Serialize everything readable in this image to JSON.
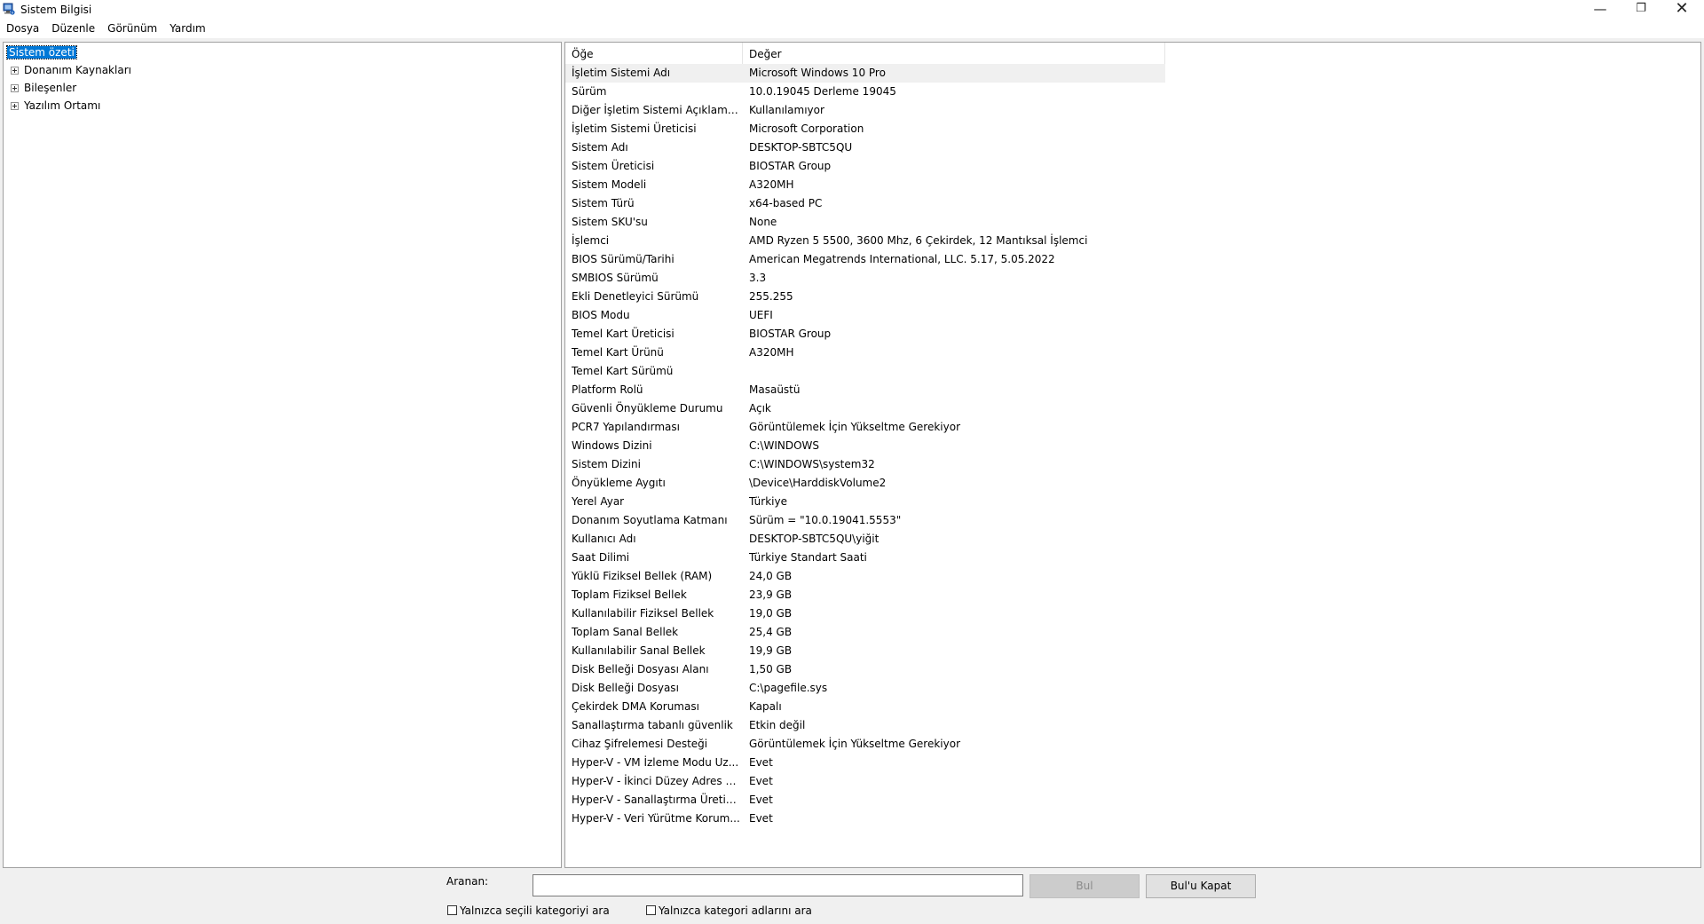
{
  "window": {
    "title": "Sistem Bilgisi",
    "app_icon": "system-information-icon",
    "controls": {
      "minimize": "—",
      "maximize": "❐",
      "close": "✕"
    }
  },
  "menu": [
    "Dosya",
    "Düzenle",
    "Görünüm",
    "Yardım"
  ],
  "tree": {
    "items": [
      {
        "label": "Sistem özeti",
        "expandable": false,
        "selected": true
      },
      {
        "label": "Donanım Kaynakları",
        "expandable": true
      },
      {
        "label": "Bileşenler",
        "expandable": true
      },
      {
        "label": "Yazılım Ortamı",
        "expandable": true
      }
    ]
  },
  "table": {
    "headers": [
      "Öğe",
      "Değer"
    ],
    "rows": [
      [
        "İşletim Sistemi Adı",
        "Microsoft Windows 10 Pro"
      ],
      [
        "Sürüm",
        "10.0.19045 Derleme 19045"
      ],
      [
        "Diğer İşletim Sistemi Açıklaması",
        "Kullanılamıyor"
      ],
      [
        "İşletim Sistemi Üreticisi",
        "Microsoft Corporation"
      ],
      [
        "Sistem Adı",
        "DESKTOP-SBTC5QU"
      ],
      [
        "Sistem Üreticisi",
        "BIOSTAR Group"
      ],
      [
        "Sistem Modeli",
        "A320MH"
      ],
      [
        "Sistem Türü",
        "x64-based PC"
      ],
      [
        "Sistem SKU'su",
        "None"
      ],
      [
        "İşlemci",
        "AMD Ryzen 5 5500, 3600 Mhz, 6 Çekirdek, 12 Mantıksal İşlemci"
      ],
      [
        "BIOS Sürümü/Tarihi",
        "American Megatrends International, LLC. 5.17, 5.05.2022"
      ],
      [
        "SMBIOS Sürümü",
        "3.3"
      ],
      [
        "Ekli Denetleyici Sürümü",
        "255.255"
      ],
      [
        "BIOS Modu",
        "UEFI"
      ],
      [
        "Temel Kart Üreticisi",
        "BIOSTAR Group"
      ],
      [
        "Temel Kart Ürünü",
        "A320MH"
      ],
      [
        "Temel Kart Sürümü",
        ""
      ],
      [
        "Platform Rolü",
        "Masaüstü"
      ],
      [
        "Güvenli Önyükleme Durumu",
        "Açık"
      ],
      [
        "PCR7 Yapılandırması",
        "Görüntülemek İçin Yükseltme Gerekiyor"
      ],
      [
        "Windows Dizini",
        "C:\\WINDOWS"
      ],
      [
        "Sistem Dizini",
        "C:\\WINDOWS\\system32"
      ],
      [
        "Önyükleme Aygıtı",
        "\\Device\\HarddiskVolume2"
      ],
      [
        "Yerel Ayar",
        "Türkiye"
      ],
      [
        "Donanım Soyutlama Katmanı",
        "Sürüm = \"10.0.19041.5553\""
      ],
      [
        "Kullanıcı Adı",
        "DESKTOP-SBTC5QU\\yiğit"
      ],
      [
        "Saat Dilimi",
        "Türkiye Standart Saati"
      ],
      [
        "Yüklü Fiziksel Bellek (RAM)",
        "24,0 GB"
      ],
      [
        "Toplam Fiziksel Bellek",
        "23,9 GB"
      ],
      [
        "Kullanılabilir Fiziksel Bellek",
        "19,0 GB"
      ],
      [
        "Toplam Sanal Bellek",
        "25,4 GB"
      ],
      [
        "Kullanılabilir Sanal Bellek",
        "19,9 GB"
      ],
      [
        "Disk Belleği Dosyası Alanı",
        "1,50 GB"
      ],
      [
        "Disk Belleği Dosyası",
        "C:\\pagefile.sys"
      ],
      [
        "Çekirdek DMA Koruması",
        "Kapalı"
      ],
      [
        "Sanallaştırma tabanlı güvenlik",
        "Etkin değil"
      ],
      [
        "Cihaz Şifrelemesi Desteği",
        "Görüntülemek İçin Yükseltme Gerekiyor"
      ],
      [
        "Hyper-V - VM İzleme Modu Uz...",
        "Evet"
      ],
      [
        "Hyper-V - İkinci Düzey Adres Ç...",
        "Evet"
      ],
      [
        "Hyper-V - Sanallaştırma Üretici ...",
        "Evet"
      ],
      [
        "Hyper-V - Veri Yürütme Korum...",
        "Evet"
      ]
    ]
  },
  "search": {
    "label": "Aranan:",
    "value": "",
    "find_button": "Bul",
    "find_enabled": false,
    "close_find_button": "Bul'u Kapat",
    "check_selected_category": {
      "label": "Yalnızca seçili kategoriyi ara",
      "checked": false
    },
    "check_category_names": {
      "label": "Yalnızca kategori adlarını ara",
      "checked": false
    }
  }
}
